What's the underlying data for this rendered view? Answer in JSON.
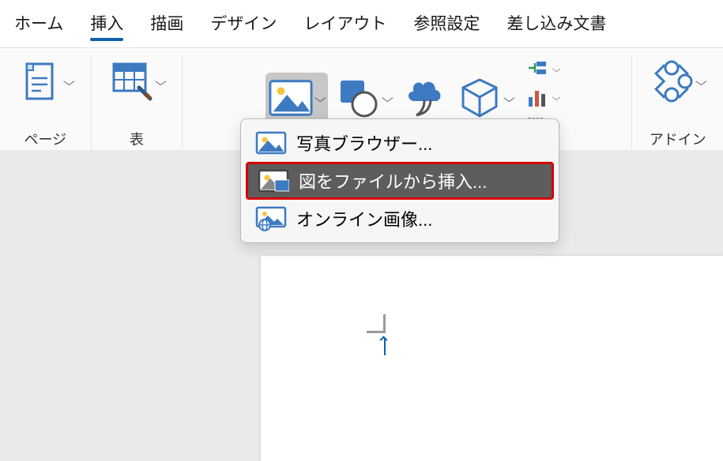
{
  "tabs": {
    "home": "ホーム",
    "insert": "挿入",
    "draw": "描画",
    "design": "デザイン",
    "layout": "レイアウト",
    "references": "参照設定",
    "mailings": "差し込み文書"
  },
  "ribbon": {
    "pages_label": "ページ",
    "tables_label": "表",
    "addins_label": "アドイン"
  },
  "picture_menu": {
    "photo_browser": "写真ブラウザー...",
    "picture_from_file": "図をファイルから挿入...",
    "online_pictures": "オンライン画像..."
  }
}
